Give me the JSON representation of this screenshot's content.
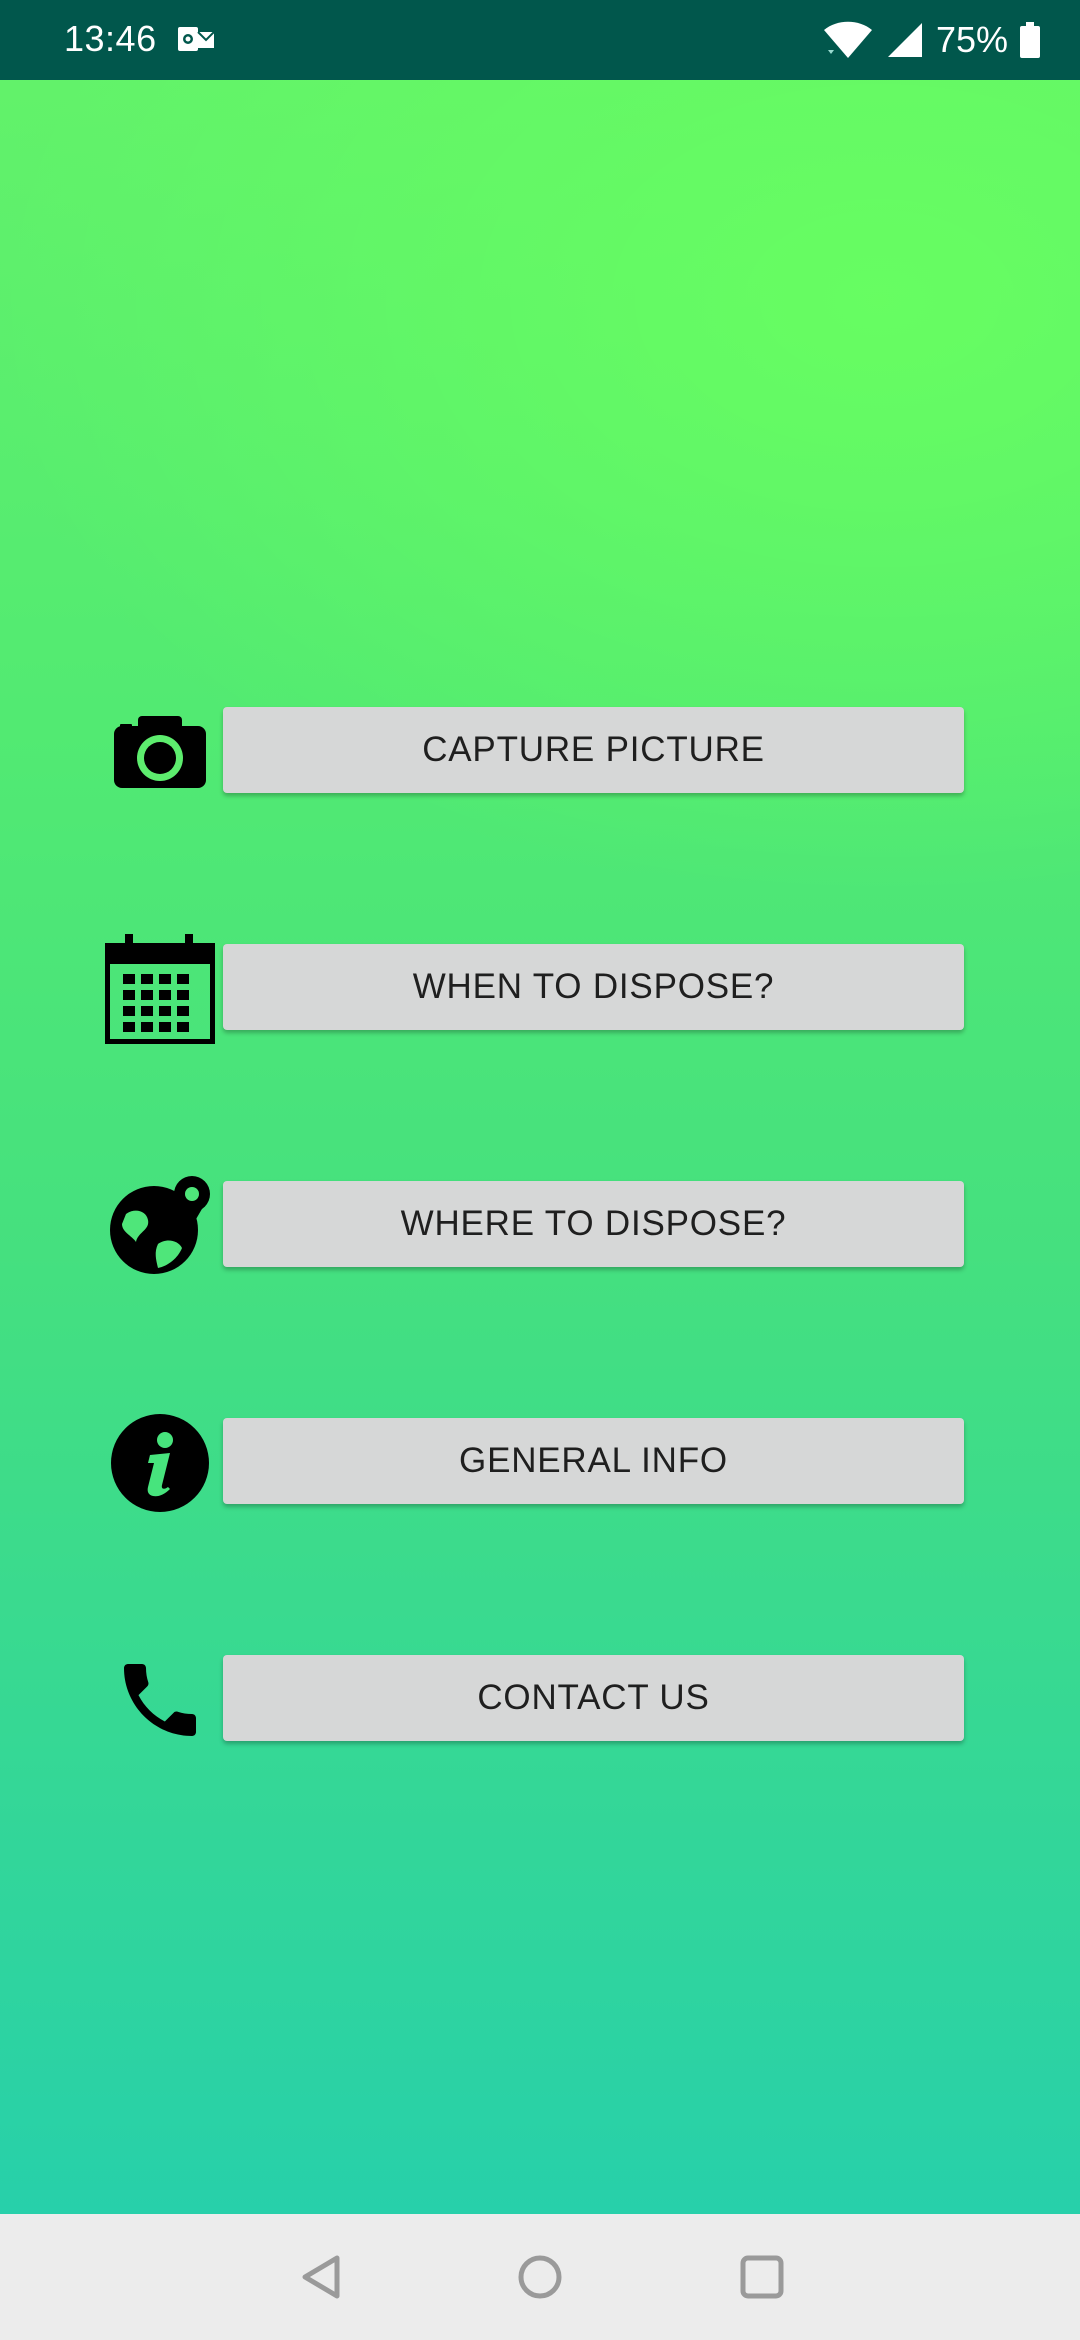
{
  "status_bar": {
    "time": "13:46",
    "battery_percent": "75%",
    "icons": [
      "outlook-notification-icon",
      "wifi-icon",
      "signal-icon",
      "battery-icon"
    ]
  },
  "menu": {
    "items": [
      {
        "label": "CAPTURE PICTURE",
        "icon": "camera-icon"
      },
      {
        "label": "WHEN TO DISPOSE?",
        "icon": "calendar-icon"
      },
      {
        "label": "WHERE TO DISPOSE?",
        "icon": "globe-location-icon"
      },
      {
        "label": "GENERAL INFO",
        "icon": "info-icon"
      },
      {
        "label": "CONTACT US",
        "icon": "phone-icon"
      }
    ]
  },
  "nav_bar": {
    "buttons": [
      "back-icon",
      "home-icon",
      "recents-icon"
    ]
  },
  "colors": {
    "status_bar": "#01574c",
    "gradient_top": "#62f26a",
    "gradient_bottom": "#27d0aa",
    "button_bg": "#d6d7d7",
    "button_text": "#1f1f1f",
    "nav_bar": "#ececec"
  }
}
